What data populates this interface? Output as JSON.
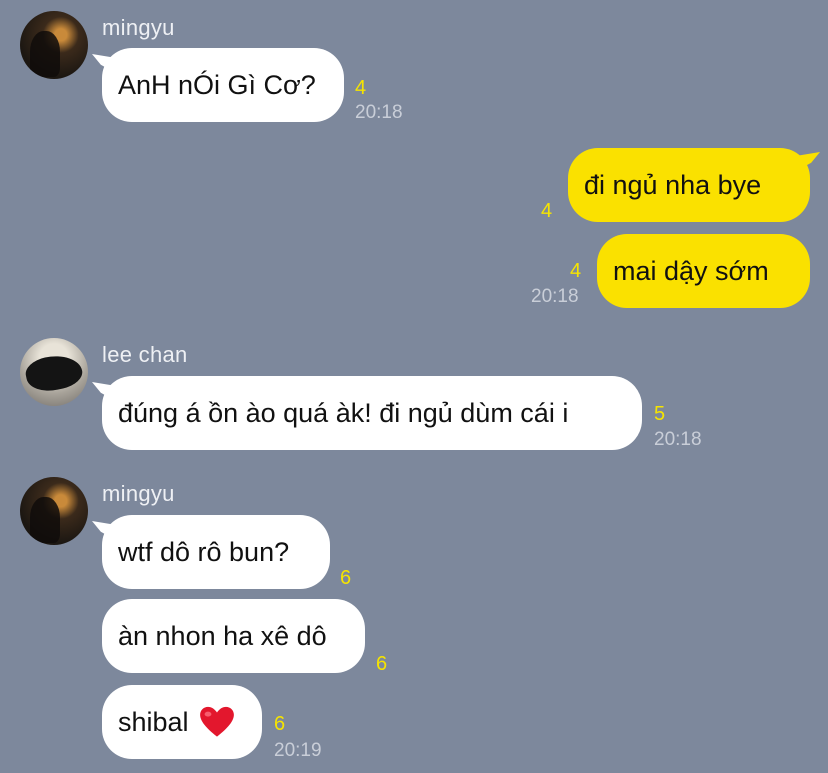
{
  "messages": [
    {
      "sender": "mingyu",
      "text": "AnH nÓi Gì Cơ?",
      "count": "4",
      "time": "20:18"
    },
    {
      "sender": "me",
      "text": "đi ngủ nha bye",
      "count": "4"
    },
    {
      "sender": "me",
      "text": "mai dậy sớm",
      "count": "4",
      "time": "20:18"
    },
    {
      "sender": "lee chan",
      "text": "đúng á ồn ào quá àk! đi ngủ dùm cái i",
      "count": "5",
      "time": "20:18"
    },
    {
      "sender": "mingyu",
      "text": "wtf dô rô bun?",
      "count": "6"
    },
    {
      "sender": "mingyu",
      "text": "àn nhon ha xê dô",
      "count": "6"
    },
    {
      "sender": "mingyu",
      "text": "shibal",
      "count": "6",
      "time": "20:19",
      "emoji": "heart-icon"
    }
  ],
  "colors": {
    "background": "#7d889c",
    "incoming": "#ffffff",
    "outgoing": "#fae100",
    "unread": "#f6e400"
  }
}
